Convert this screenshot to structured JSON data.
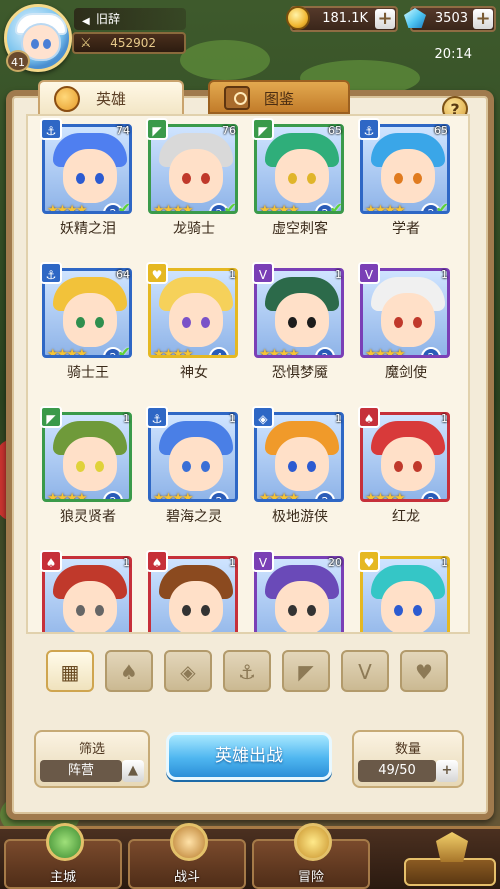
{
  "player": {
    "name": "旧辞",
    "level": "41",
    "power": "452902"
  },
  "resources": {
    "gold": "181.1K",
    "gems": "3503"
  },
  "time": "20:14",
  "tabs": {
    "heroes": "英雄",
    "codex": "图鉴"
  },
  "help_label": "?",
  "heroes": [
    {
      "name": "妖精之泪",
      "level": "74",
      "stars": "★★★★",
      "rank": "2",
      "deployed": "✔",
      "type_icon": "anchor-icon",
      "type_glyph": "⚓",
      "type_color": "#2e67c5",
      "hair": "#4f7ff0",
      "eyes": "#2c5bd1"
    },
    {
      "name": "龙骑士",
      "level": "76",
      "stars": "★★★★",
      "rank": "2",
      "deployed": "✔",
      "type_icon": "dragon-icon",
      "type_glyph": "◤",
      "type_color": "#3a9a4a",
      "hair": "#d9d9d9",
      "eyes": "#c0392b"
    },
    {
      "name": "虚空刺客",
      "level": "65",
      "stars": "★★★★",
      "rank": "2",
      "deployed": "✔",
      "type_icon": "dragon-icon",
      "type_glyph": "◤",
      "type_color": "#3a9a4a",
      "hair": "#2fae7a",
      "eyes": "#e0b52a"
    },
    {
      "name": "学者",
      "level": "65",
      "stars": "★★★★",
      "rank": "2",
      "deployed": "✔",
      "type_icon": "anchor-icon",
      "type_glyph": "⚓",
      "type_color": "#2e67c5",
      "hair": "#3aa6e8",
      "eyes": "#e07b1f"
    },
    {
      "name": "骑士王",
      "level": "64",
      "stars": "★★★★",
      "rank": "2",
      "deployed": "✔",
      "type_icon": "anchor-icon",
      "type_glyph": "⚓",
      "type_color": "#2e67c5",
      "hair": "#f2c23a",
      "eyes": "#2f8f4e"
    },
    {
      "name": "神女",
      "level": "1",
      "stars": "★★★★",
      "rank": "4",
      "deployed": "",
      "type_icon": "heart-icon",
      "type_glyph": "♥",
      "type_color": "#e5b822",
      "hair": "#f6d15a",
      "eyes": "#7a52c8"
    },
    {
      "name": "恐惧梦魇",
      "level": "1",
      "stars": "★★★★",
      "rank": "2",
      "deployed": "",
      "type_icon": "horns-icon",
      "type_glyph": "V",
      "type_color": "#7a3fb6",
      "hair": "#2c6a4a",
      "eyes": "#1c1c1c"
    },
    {
      "name": "魔剑使",
      "level": "1",
      "stars": "★★★★",
      "rank": "2",
      "deployed": "",
      "type_icon": "horns-icon",
      "type_glyph": "V",
      "type_color": "#7a3fb6",
      "hair": "#f0f0f0",
      "eyes": "#c0392b"
    },
    {
      "name": "狼灵贤者",
      "level": "1",
      "stars": "★★★★",
      "rank": "2",
      "deployed": "",
      "type_icon": "dragon-icon",
      "type_glyph": "◤",
      "type_color": "#3a9a4a",
      "hair": "#6f9a3a",
      "eyes": "#e0d23a"
    },
    {
      "name": "碧海之灵",
      "level": "1",
      "stars": "★★★★",
      "rank": "2",
      "deployed": "",
      "type_icon": "anchor-icon",
      "type_glyph": "⚓",
      "type_color": "#2e67c5",
      "hair": "#4a7fe6",
      "eyes": "#3a6fd6"
    },
    {
      "name": "极地游侠",
      "level": "1",
      "stars": "★★★★",
      "rank": "2",
      "deployed": "",
      "type_icon": "diamond-icon",
      "type_glyph": "◈",
      "type_color": "#2e67c5",
      "hair": "#f09a2a",
      "eyes": "#2c5bd1"
    },
    {
      "name": "红龙",
      "level": "1",
      "stars": "★★★★",
      "rank": "2",
      "deployed": "",
      "type_icon": "flame-icon",
      "type_glyph": "♠",
      "type_color": "#c6303a",
      "hair": "#d83a3a",
      "eyes": "#c0392b"
    },
    {
      "name": "",
      "level": "1",
      "stars": "",
      "rank": "",
      "deployed": "",
      "type_icon": "flame-icon",
      "type_glyph": "♠",
      "type_color": "#c6303a",
      "hair": "#c0392b",
      "eyes": "#666666"
    },
    {
      "name": "",
      "level": "1",
      "stars": "",
      "rank": "",
      "deployed": "",
      "type_icon": "flame-icon",
      "type_glyph": "♠",
      "type_color": "#c6303a",
      "hair": "#8b4a1f",
      "eyes": "#333333"
    },
    {
      "name": "",
      "level": "20",
      "stars": "",
      "rank": "",
      "deployed": "",
      "type_icon": "horns-icon",
      "type_glyph": "V",
      "type_color": "#7a3fb6",
      "hair": "#6a4ab8",
      "eyes": "#333333"
    },
    {
      "name": "",
      "level": "1",
      "stars": "",
      "rank": "",
      "deployed": "",
      "type_icon": "heart-icon",
      "type_glyph": "♥",
      "type_color": "#e5b822",
      "hair": "#35c6c6",
      "eyes": "#2c5bd1"
    }
  ],
  "filters": [
    {
      "icon": "all-grid-icon",
      "glyph": "▦",
      "active": true
    },
    {
      "icon": "flame-icon",
      "glyph": "♠",
      "active": false
    },
    {
      "icon": "diamond-icon",
      "glyph": "◈",
      "active": false
    },
    {
      "icon": "anchor-icon",
      "glyph": "⚓",
      "active": false
    },
    {
      "icon": "dragon-icon",
      "glyph": "◤",
      "active": false
    },
    {
      "icon": "horns-icon",
      "glyph": "V",
      "active": false
    },
    {
      "icon": "heart-icon",
      "glyph": "♥",
      "active": false
    }
  ],
  "bottom": {
    "filter_label": "筛选",
    "filter_value": "阵营",
    "deploy_label": "英雄出战",
    "count_label": "数量",
    "count_value": "49/50"
  },
  "nav": {
    "main_city": "主城",
    "battle": "战斗",
    "adventure": "冒险"
  },
  "colors": {
    "panel": "#f3ebd9",
    "deploy_button": "#4fb6f0",
    "frame": "#a07a4d"
  }
}
